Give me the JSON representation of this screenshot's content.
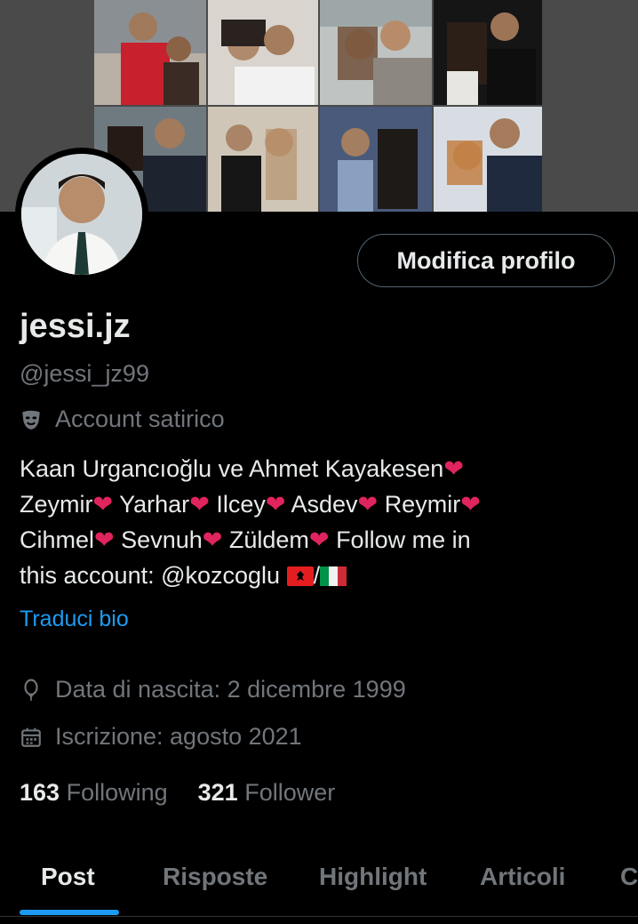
{
  "banner": {
    "description_icon": "photo-collage"
  },
  "profile": {
    "display_name": "jessi.jz",
    "handle": "@jessi_jz99",
    "label": "Account satirico",
    "label_icon": "theater-mask-icon",
    "bio_lines": [
      "Kaan Urgancıoğlu ve Ahmet Kayakesen",
      "Zeymir",
      "Yarhar",
      "Ilcey",
      "Asdev",
      "Reymir",
      "Cihmel",
      "Sevnuh",
      "Züldem",
      "Follow me in",
      "this account: @kozcoglu",
      "/"
    ],
    "translate_label": "Traduci bio",
    "birthdate": "Data di nascita: 2 dicembre 1999",
    "joined": "Iscrizione: agosto 2021",
    "following_count": "163",
    "following_label": "Following",
    "followers_count": "321",
    "followers_label": "Follower"
  },
  "actions": {
    "edit_profile_label": "Modifica profilo"
  },
  "tabs": [
    {
      "label": "Post",
      "active": true
    },
    {
      "label": "Risposte",
      "active": false
    },
    {
      "label": "Highlight",
      "active": false
    },
    {
      "label": "Articoli",
      "active": false
    },
    {
      "label": "C",
      "active": false
    }
  ],
  "colors": {
    "accent": "#1d9bf0",
    "muted": "#71767b",
    "heart": "#e0245e",
    "background": "#000000"
  }
}
